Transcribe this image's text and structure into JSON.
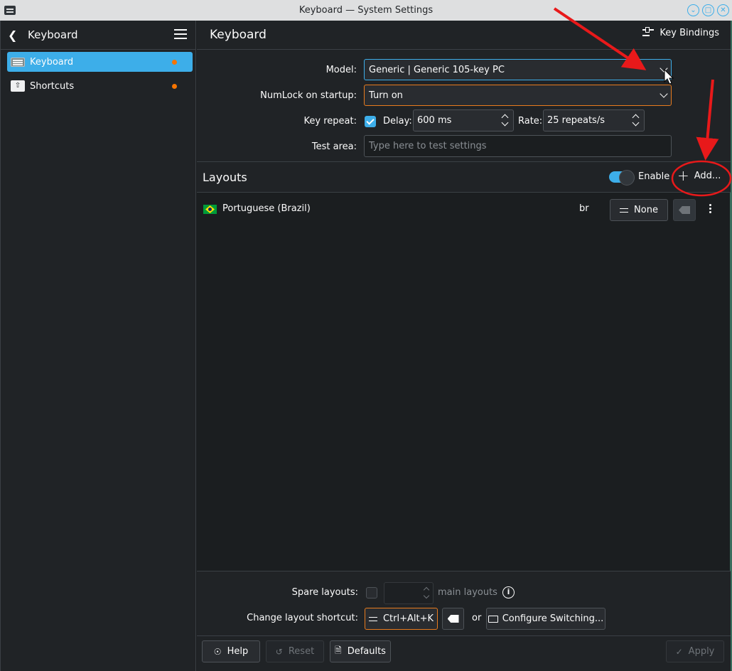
{
  "window": {
    "title": "Keyboard — System Settings"
  },
  "sidebar": {
    "title": "Keyboard",
    "items": [
      {
        "label": "Keyboard",
        "active": true,
        "modified": true
      },
      {
        "label": "Shortcuts",
        "active": false,
        "modified": true
      }
    ]
  },
  "header": {
    "title": "Keyboard",
    "key_bindings_label": "Key Bindings"
  },
  "form": {
    "model_label": "Model:",
    "model_value": "Generic | Generic 105-key PC",
    "numlock_label": "NumLock on startup:",
    "numlock_value": "Turn on",
    "key_repeat_label": "Key repeat:",
    "key_repeat_enabled": true,
    "delay_label": "Delay:",
    "delay_value": "600 ms",
    "rate_label": "Rate:",
    "rate_value": "25 repeats/s",
    "test_area_label": "Test area:",
    "test_area_placeholder": "Type here to test settings"
  },
  "layouts": {
    "title": "Layouts",
    "enable_label": "Enable",
    "enabled": true,
    "add_label": "Add...",
    "rows": [
      {
        "flag": "brazil-flag",
        "name": "Portuguese (Brazil)",
        "code": "br",
        "variant_label": "None"
      }
    ]
  },
  "bottom": {
    "spare_label": "Spare layouts:",
    "spare_suffix": "main layouts",
    "shortcut_label": "Change layout shortcut:",
    "shortcut_value": "Ctrl+Alt+K",
    "or_label": "or",
    "configure_label": "Configure Switching..."
  },
  "footer": {
    "help_label": "Help",
    "reset_label": "Reset",
    "defaults_label": "Defaults",
    "apply_label": "Apply"
  },
  "colors": {
    "accent": "#3daee9",
    "modified_dot": "#f67400",
    "annotation": "#e8191a"
  }
}
